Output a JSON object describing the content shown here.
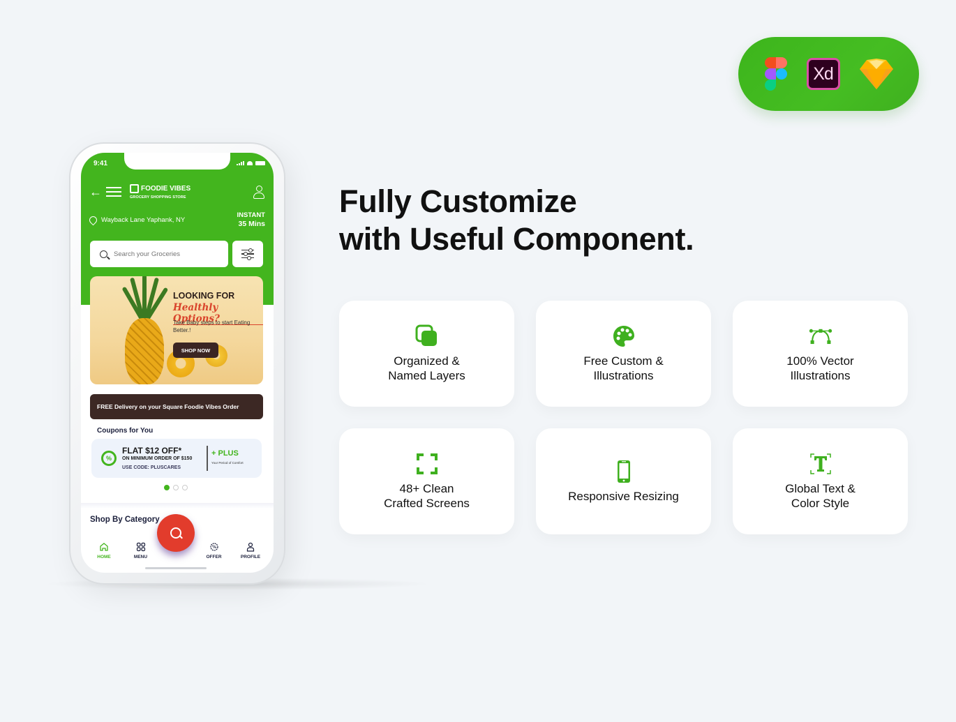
{
  "tools": {
    "items": [
      {
        "name": "Figma",
        "icon": "figma-icon"
      },
      {
        "name": "Adobe XD",
        "icon": "xd-icon",
        "label": "Xd"
      },
      {
        "name": "Sketch",
        "icon": "sketch-icon"
      }
    ],
    "pill_color": "#43b51e"
  },
  "phone": {
    "status_time": "9:41",
    "brand_name": "FOODIE VIBES",
    "brand_sub": "GROCERY SHOPPING STORE",
    "location": "Wayback Lane Yaphank, NY",
    "eta_label": "INSTANT",
    "eta_value": "35 Mins",
    "search_placeholder": "Search your Groceries",
    "promo": {
      "title": "LOOKING FOR",
      "subtitle": "Healthly Options?",
      "description": "Take Baby steps to start Eating Better.!",
      "cta": "SHOP NOW"
    },
    "delivery_banner": "FREE Delivery on your Square Foodie Vibes Order",
    "coupons_title": "Coupons for You",
    "coupon": {
      "headline": "FLAT $12 OFF*",
      "condition": "ON MINIMUM ORDER OF $150",
      "code": "USE CODE: PLUSCARES",
      "plus_label": "+ PLUS",
      "plus_sub": "Your Period of Comfort",
      "badge": "%"
    },
    "carousel": {
      "count": 3,
      "active_index": 0
    },
    "section_title": "Shop By Category",
    "nav": [
      {
        "label": "HOME",
        "icon": "home-icon",
        "active": true
      },
      {
        "label": "MENU",
        "icon": "grid-icon",
        "active": false
      },
      {
        "label": "OFFER",
        "icon": "offer-icon",
        "active": false
      },
      {
        "label": "PROFILE",
        "icon": "profile-icon",
        "active": false
      }
    ],
    "accent": "#43b51e",
    "fab_color": "#e23c2c"
  },
  "headline": {
    "line1": "Fully Customize",
    "line2": "with Useful Component."
  },
  "features": [
    {
      "label": "Organized &\nNamed Layers",
      "icon": "layers-icon"
    },
    {
      "label": "Free Custom &\nIllustrations",
      "icon": "palette-icon"
    },
    {
      "label": "100% Vector\nIllustrations",
      "icon": "bezier-curve-icon"
    },
    {
      "label": "48+ Clean\nCrafted Screens",
      "icon": "fullscreen-frame-icon"
    },
    {
      "label": "Responsive Resizing",
      "icon": "smartphone-icon"
    },
    {
      "label": "Global Text &\nColor Style",
      "icon": "text-style-icon"
    }
  ]
}
